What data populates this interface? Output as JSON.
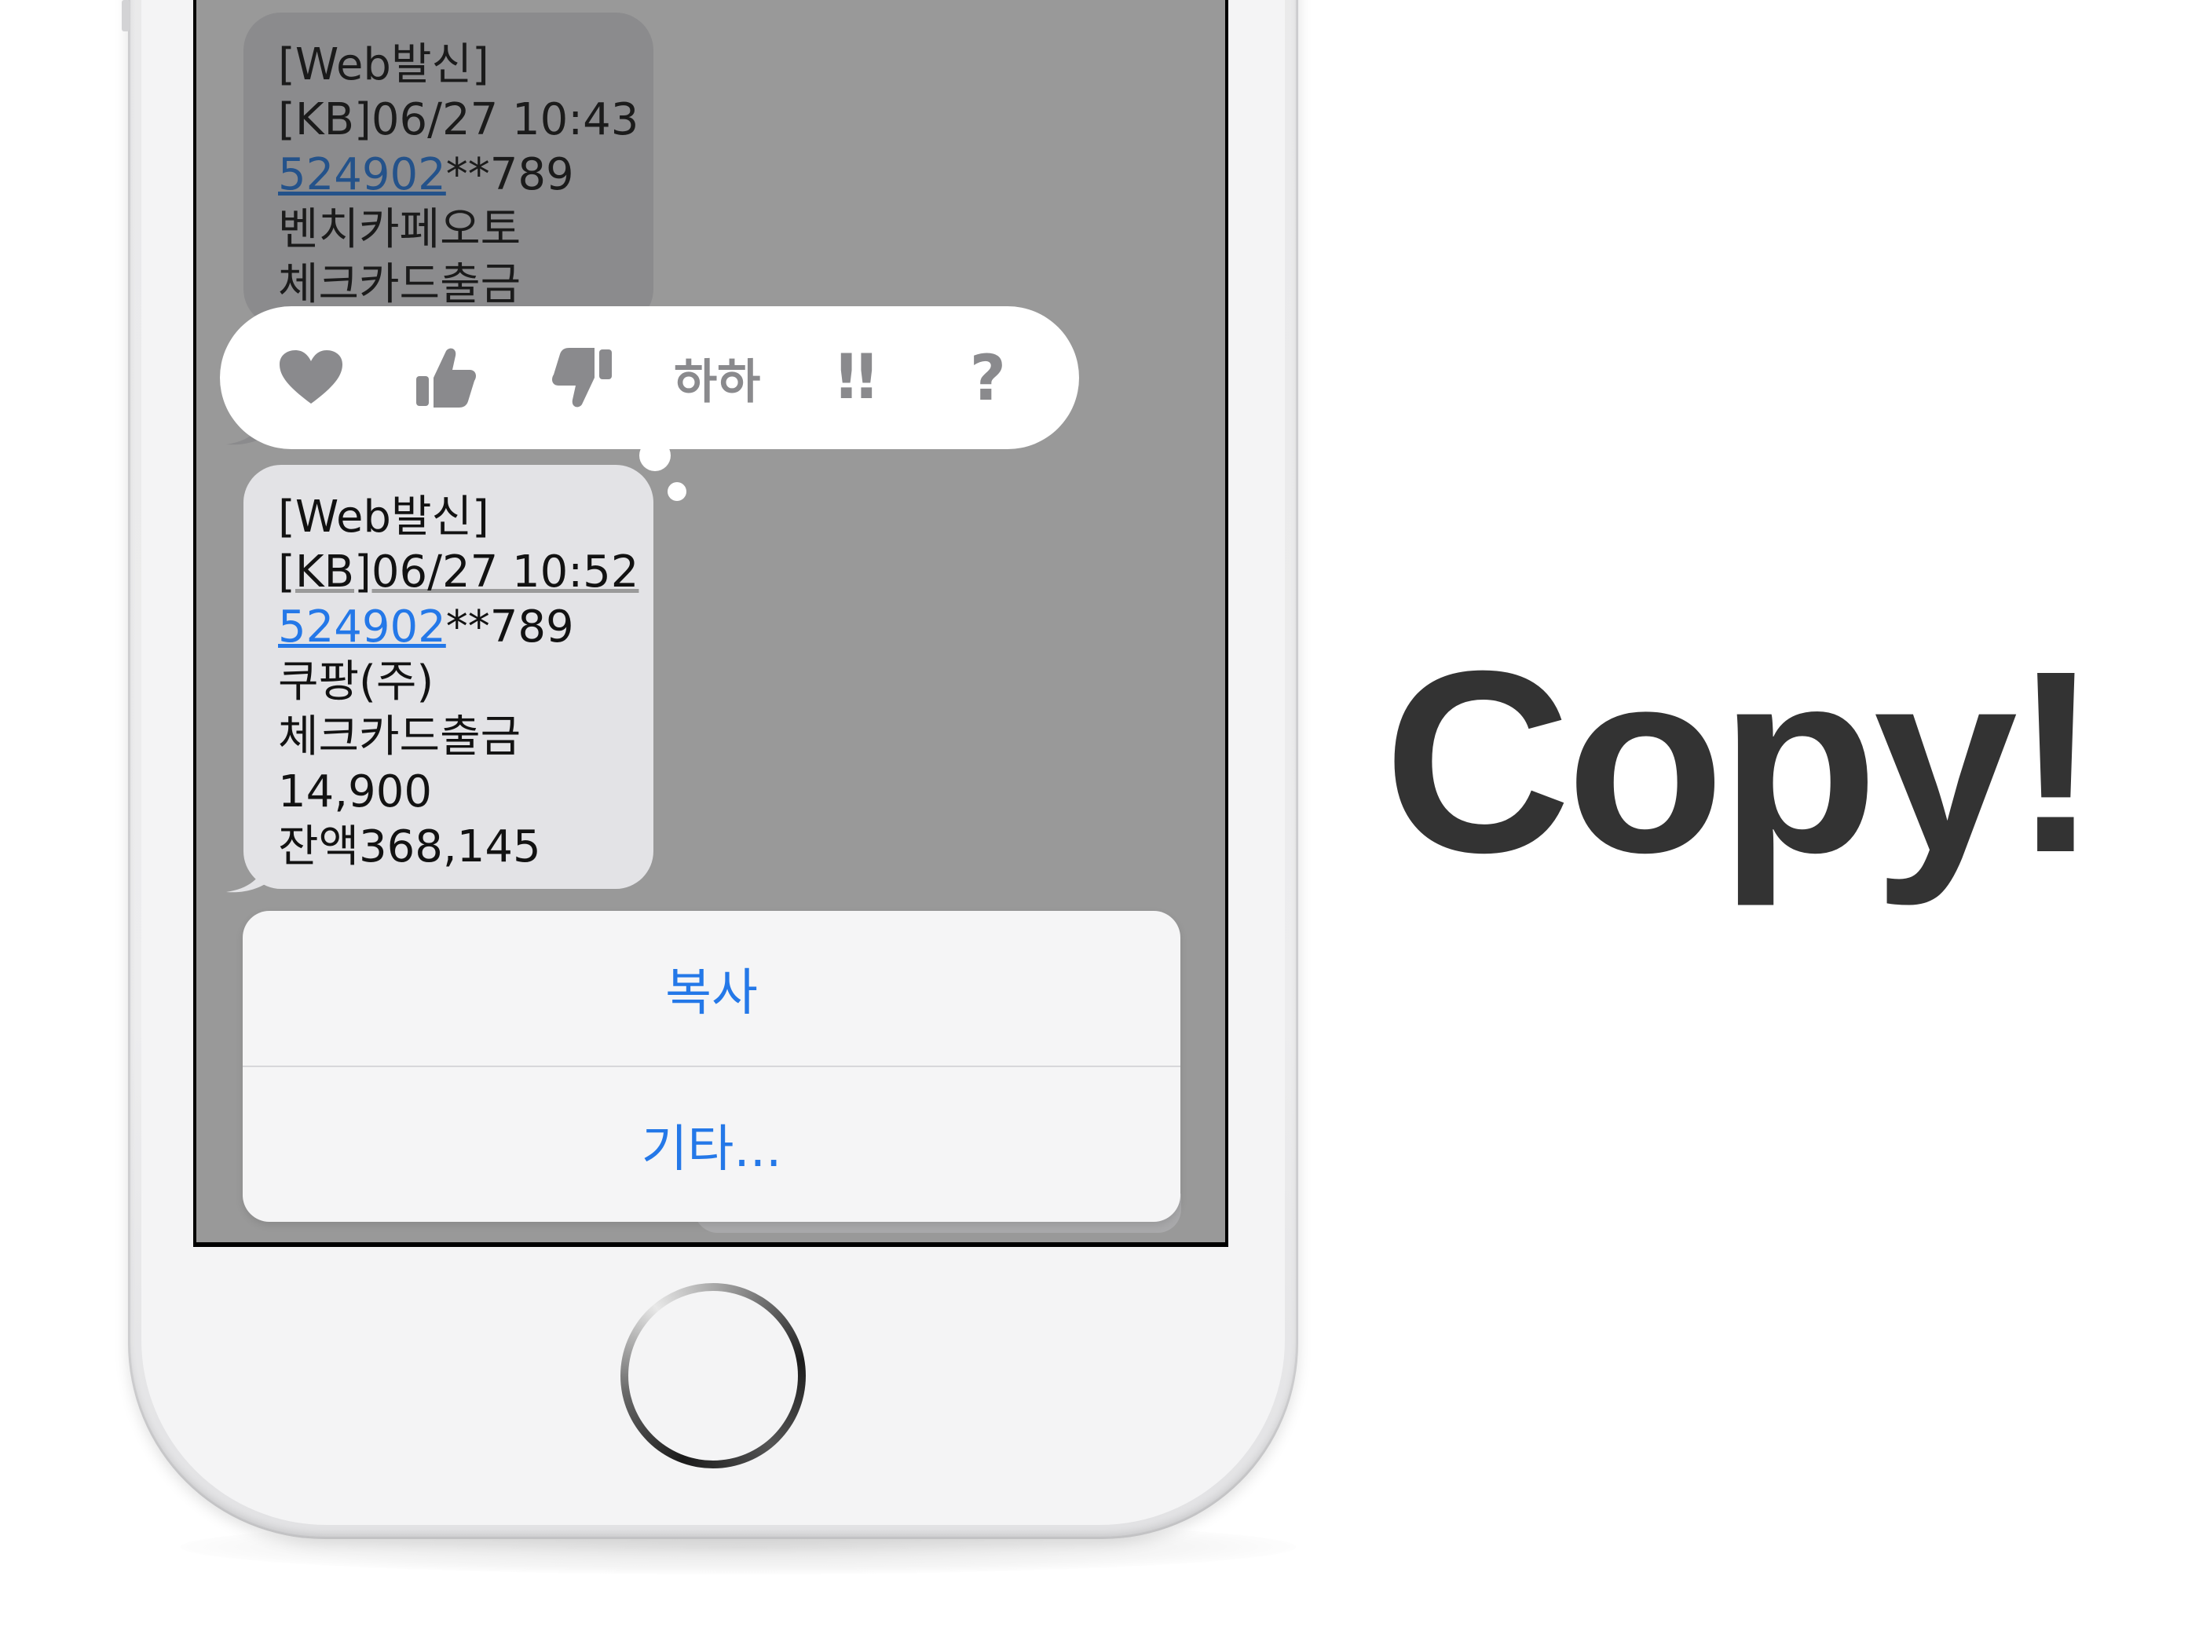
{
  "headline": "Copy!",
  "messages": [
    {
      "lines": [
        "[Web발신]",
        "[KB]06/27 10:43"
      ],
      "card_link": "524902",
      "card_suffix": "**789",
      "more_lines": [
        "벤치카페오토",
        "체크카드출금"
      ]
    },
    {
      "lines": [
        "[Web발신]",
        "[KB]06/27 10:52"
      ],
      "card_link": "524902",
      "card_suffix": "**789",
      "more_lines": [
        "쿠팡(주)",
        "체크카드출금",
        "14,900",
        "잔액368,145"
      ]
    }
  ],
  "reactions": {
    "heart": "heart-icon",
    "thumbs_up": "thumbs-up-icon",
    "thumbs_down": "thumbs-down-icon",
    "haha": "하하",
    "exclaim": "!!",
    "question": "?"
  },
  "menu": {
    "copy": "복사",
    "more": "기타..."
  },
  "colors": {
    "link": "#1a5fb4",
    "menu_text": "#2478e8",
    "headline": "#333333",
    "screen_dim": "#999999"
  }
}
